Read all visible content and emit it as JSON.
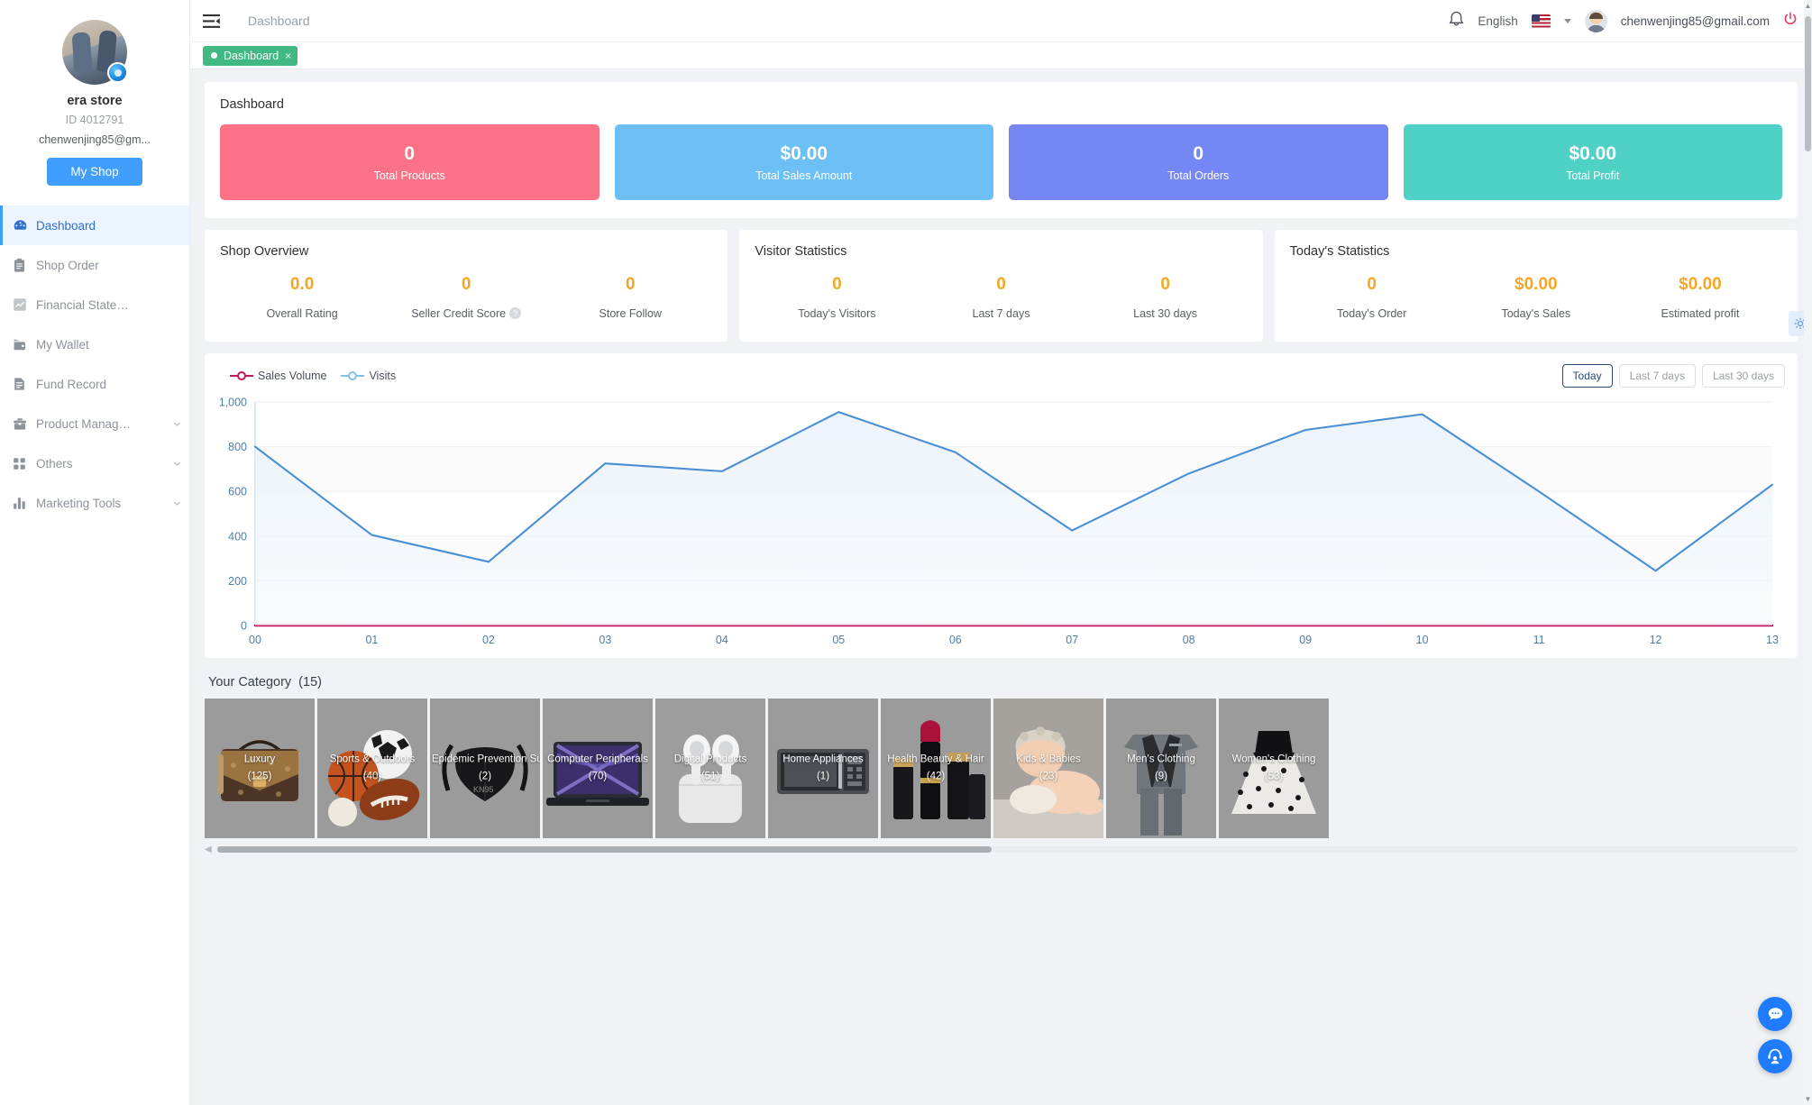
{
  "sidebar": {
    "shop_name": "era store",
    "shop_id": "ID 4012791",
    "shop_email": "chenwenjing85@gm...",
    "my_shop_button": "My Shop",
    "items": [
      {
        "label": "Dashboard",
        "icon": "dashboard-icon",
        "active": true,
        "expandable": false
      },
      {
        "label": "Shop Order",
        "icon": "clipboard-icon",
        "active": false,
        "expandable": false
      },
      {
        "label": "Financial State…",
        "icon": "chart-line-icon",
        "active": false,
        "expandable": false
      },
      {
        "label": "My Wallet",
        "icon": "wallet-icon",
        "active": false,
        "expandable": false
      },
      {
        "label": "Fund Record",
        "icon": "document-icon",
        "active": false,
        "expandable": false
      },
      {
        "label": "Product Manag…",
        "icon": "briefcase-icon",
        "active": false,
        "expandable": true
      },
      {
        "label": "Others",
        "icon": "grid-icon",
        "active": false,
        "expandable": true
      },
      {
        "label": "Marketing Tools",
        "icon": "bar-chart-icon",
        "active": false,
        "expandable": true
      }
    ]
  },
  "topbar": {
    "breadcrumb": "Dashboard",
    "language": "English",
    "user_email": "chenwenjing85@gmail.com"
  },
  "tabs": [
    {
      "label": "Dashboard",
      "closable": "×"
    }
  ],
  "dashboard": {
    "title": "Dashboard",
    "kpis": [
      {
        "value": "0",
        "label": "Total Products",
        "color": "#fb7185"
      },
      {
        "value": "$0.00",
        "label": "Total Sales Amount",
        "color": "#6cc0f5"
      },
      {
        "value": "0",
        "label": "Total Orders",
        "color": "#7586f5"
      },
      {
        "value": "$0.00",
        "label": "Total Profit",
        "color": "#4fd1c5"
      }
    ]
  },
  "panels": [
    {
      "title": "Shop Overview",
      "items": [
        {
          "value": "0.0",
          "label": "Overall Rating",
          "help": false
        },
        {
          "value": "0",
          "label": "Seller Credit Score",
          "help": true
        },
        {
          "value": "0",
          "label": "Store Follow",
          "help": false
        }
      ]
    },
    {
      "title": "Visitor Statistics",
      "items": [
        {
          "value": "0",
          "label": "Today's Visitors",
          "help": false
        },
        {
          "value": "0",
          "label": "Last 7 days",
          "help": false
        },
        {
          "value": "0",
          "label": "Last 30 days",
          "help": false
        }
      ]
    },
    {
      "title": "Today's Statistics",
      "items": [
        {
          "value": "0",
          "label": "Today's Order",
          "help": false
        },
        {
          "value": "$0.00",
          "label": "Today's Sales",
          "help": false
        },
        {
          "value": "$0.00",
          "label": "Estimated profit",
          "help": false
        }
      ]
    }
  ],
  "chart_controls": {
    "ranges": [
      {
        "label": "Today",
        "active": true
      },
      {
        "label": "Last 7 days",
        "active": false
      },
      {
        "label": "Last 30 days",
        "active": false
      }
    ]
  },
  "chart_data": {
    "type": "line",
    "title": "",
    "xlabel": "",
    "ylabel": "",
    "grid": true,
    "legend_position": "top-left",
    "x": [
      "00",
      "01",
      "02",
      "03",
      "04",
      "05",
      "06",
      "07",
      "08",
      "09",
      "10",
      "11",
      "12",
      "13"
    ],
    "ylim": [
      0,
      1000
    ],
    "yticks": [
      0,
      200,
      400,
      600,
      800,
      1000
    ],
    "ytick_labels": [
      "0",
      "200",
      "400",
      "600",
      "800",
      "1,000"
    ],
    "series": [
      {
        "name": "Sales Volume",
        "color": "#c2185b",
        "values": [
          0,
          0,
          0,
          0,
          0,
          0,
          0,
          0,
          0,
          0,
          0,
          0,
          0,
          0
        ]
      },
      {
        "name": "Visits",
        "color": "#4a8fd4",
        "values": [
          800,
          405,
          285,
          725,
          690,
          955,
          775,
          425,
          680,
          875,
          945,
          600,
          245,
          630
        ]
      }
    ]
  },
  "category": {
    "heading": "Your Category",
    "count": "(15)",
    "tiles": [
      {
        "name": "Luxury",
        "count": "(125)",
        "image": "handbag-photo"
      },
      {
        "name": "Sports & Outdoors",
        "count": "(40)",
        "image": "sports-balls-photo"
      },
      {
        "name": "Epidemic Prevention Supplies",
        "count": "(2)",
        "image": "face-mask-photo"
      },
      {
        "name": "Computer Peripherals",
        "count": "(70)",
        "image": "laptop-photo"
      },
      {
        "name": "Digital Products",
        "count": "(51)",
        "image": "earbuds-photo"
      },
      {
        "name": "Home Appliances",
        "count": "(1)",
        "image": "microwave-photo"
      },
      {
        "name": "Health Beauty & Hair",
        "count": "(42)",
        "image": "lipstick-photo"
      },
      {
        "name": "Kids & Babies",
        "count": "(23)",
        "image": "baby-photo"
      },
      {
        "name": "Men's Clothing",
        "count": "(9)",
        "image": "suit-photo"
      },
      {
        "name": "Women's Clothing",
        "count": "(53)",
        "image": "dress-photo"
      }
    ]
  }
}
